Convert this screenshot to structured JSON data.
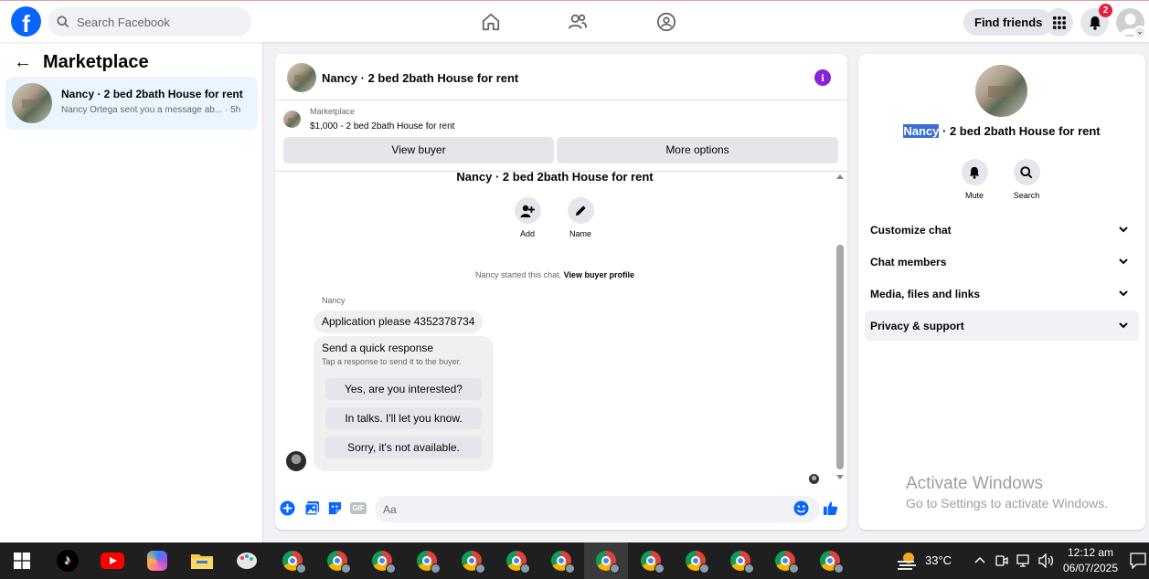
{
  "topbar": {
    "logo": "f",
    "search_placeholder": "Search Facebook",
    "find_friends": "Find friends",
    "notification_count": "2"
  },
  "left": {
    "back_arrow": "←",
    "title": "Marketplace",
    "conversation": {
      "title": "Nancy · 2 bed 2bath House for rent",
      "preview": "Nancy Ortega sent you a message ab...",
      "time": "· 5h"
    }
  },
  "chat": {
    "header_title": "Nancy · 2 bed 2bath House for rent",
    "info_glyph": "i",
    "marketplace_label": "Marketplace",
    "listing": "$1,000 - 2 bed 2bath House for rent",
    "view_buyer": "View buyer",
    "more_options": "More options",
    "thread_title": "Nancy · 2 bed 2bath House for rent",
    "actions": [
      {
        "label": "Add",
        "icon": "add-person-icon"
      },
      {
        "label": "Name",
        "icon": "pencil-icon"
      }
    ],
    "started_text": "Nancy started this chat.",
    "view_buyer_profile": "View buyer profile",
    "sender": "Nancy",
    "message": "Application please 4352378734",
    "quick_response": {
      "title": "Send a quick response",
      "subtitle": "Tap a response to send it to the buyer.",
      "options": [
        "Yes, are you interested?",
        "In talks. I'll let you know.",
        "Sorry, it's not available."
      ]
    },
    "composer_placeholder": "Aa",
    "gif_label": "GIF"
  },
  "right": {
    "title_highlight": "Nancy",
    "title_rest": " · 2 bed 2bath House for rent",
    "actions": [
      {
        "label": "Mute",
        "icon": "bell-icon"
      },
      {
        "label": "Search",
        "icon": "search-icon"
      }
    ],
    "sections": [
      "Customize chat",
      "Chat members",
      "Media, files and links",
      "Privacy & support"
    ]
  },
  "watermark": {
    "line1": "Activate Windows",
    "line2": "Go to Settings to activate Windows."
  },
  "taskbar": {
    "temperature": "33°C",
    "time": "12:12 am",
    "date": "06/07/2025"
  },
  "colors": {
    "facebook_blue": "#0866ff",
    "selected_conversation": "#ebf5ff",
    "info_purple": "#8a22d9",
    "notification_red": "#e41e3f"
  }
}
